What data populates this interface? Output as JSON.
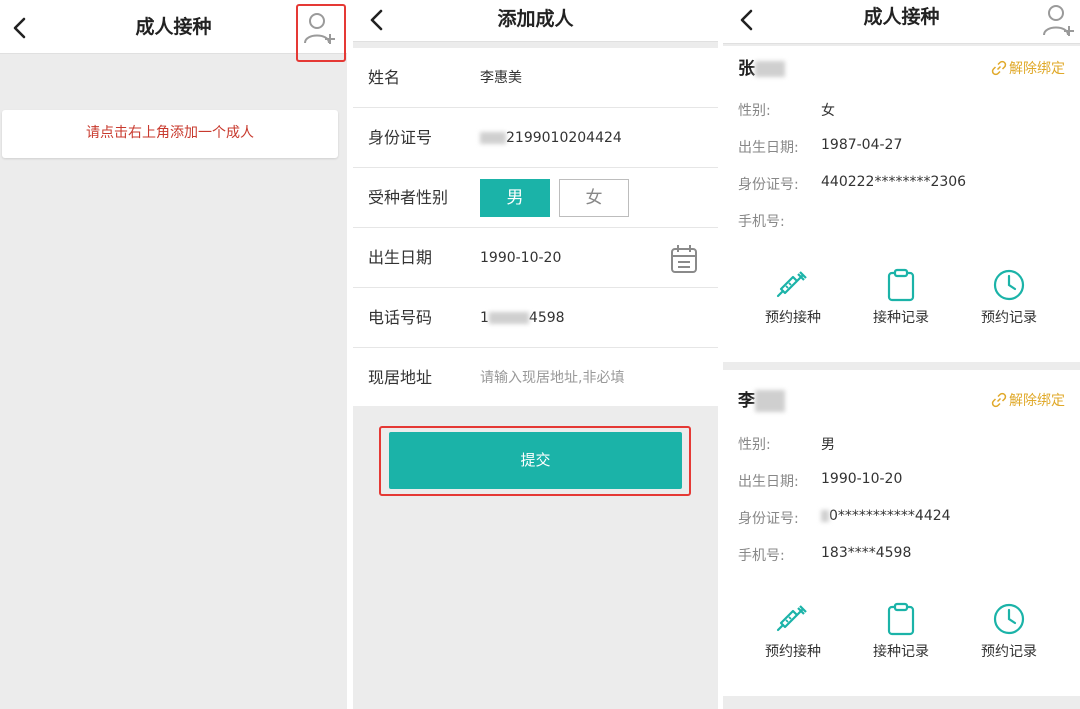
{
  "screen1": {
    "title": "成人接种",
    "hint": "请点击右上角添加一个成人"
  },
  "screen2": {
    "title": "添加成人",
    "fields": [
      {
        "label": "姓名",
        "value": "李惠美"
      },
      {
        "label": "身份证号",
        "value": "2199010204424"
      },
      {
        "label": "受种者性别",
        "options": [
          "男",
          "女"
        ],
        "selected": "男"
      },
      {
        "label": "出生日期",
        "value": "1990-10-20"
      },
      {
        "label": "电话号码",
        "value_start": "1",
        "value_end": "4598"
      },
      {
        "label": "现居地址",
        "placeholder": "请输入现居地址,非必填"
      }
    ],
    "submit_label": "提交",
    "accent_color": "#1bb3a8"
  },
  "screen3": {
    "title": "成人接种",
    "unbind_label": "解除绑定",
    "field_labels": {
      "gender": "性别:",
      "birth": "出生日期:",
      "id": "身份证号:",
      "phone": "手机号:"
    },
    "persons": [
      {
        "name": "张",
        "gender": "女",
        "birth": "1987-04-27",
        "id": "440222********2306",
        "phone": ""
      },
      {
        "name": "李",
        "gender": "男",
        "birth": "1990-10-20",
        "id": "0***********4424",
        "phone": "183****4598"
      }
    ],
    "actions": [
      "预约接种",
      "接种记录",
      "预约记录"
    ],
    "icon_names": [
      "syringe-icon",
      "clipboard-icon",
      "clock-icon"
    ]
  },
  "colors": {
    "accent": "#1bb3a8",
    "hint_red": "#c83a2e",
    "unbind_gold": "#e0a92a",
    "highlight_red": "#e53935"
  }
}
